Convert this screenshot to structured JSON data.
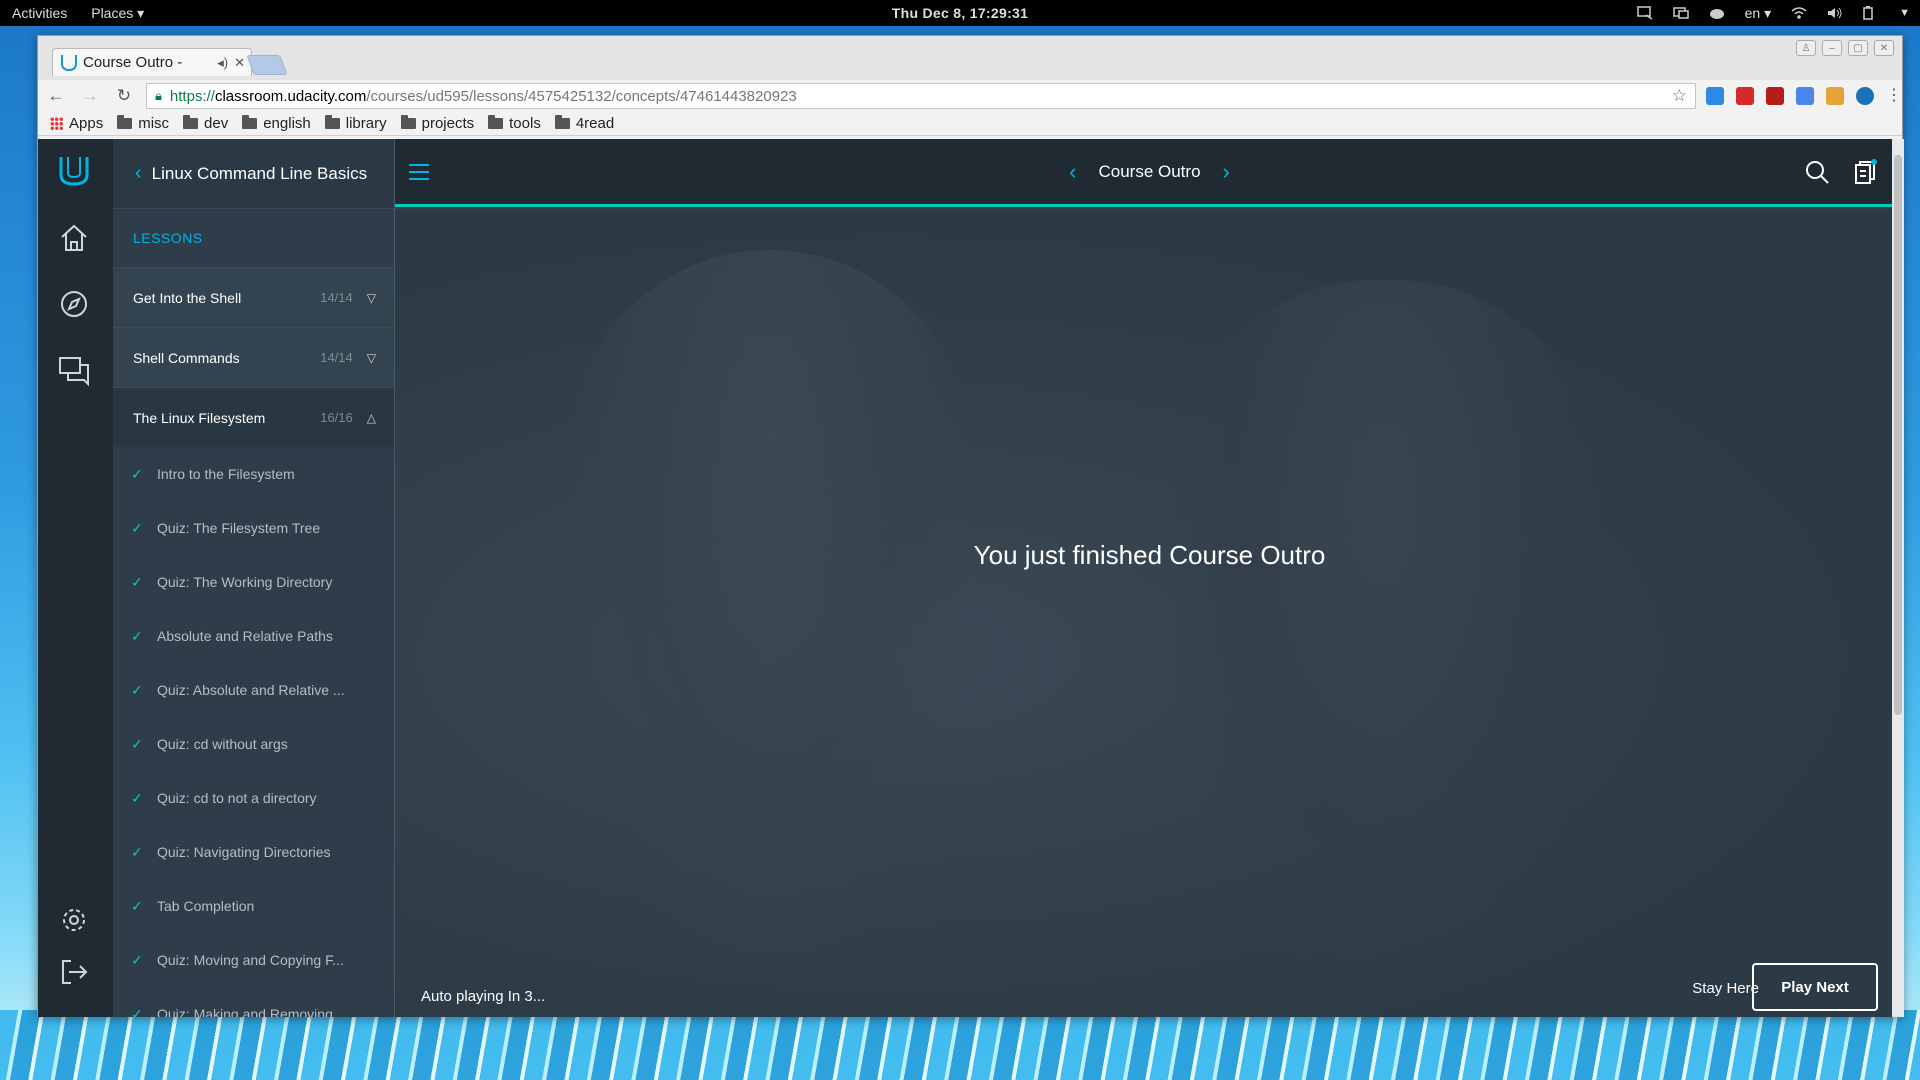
{
  "topbar": {
    "activities": "Activities",
    "places": "Places ▾",
    "clock": "Thu Dec  8, 17:29:31",
    "language": "en ▾"
  },
  "browser": {
    "tab_title": "Course Outro -",
    "url_scheme": "https://",
    "url_host": "classroom.udacity.com",
    "url_path": "/courses/ud595/lessons/4575425132/concepts/47461443820923",
    "bookmarks": [
      "Apps",
      "misc",
      "dev",
      "english",
      "library",
      "projects",
      "tools",
      "4read"
    ]
  },
  "sidebar": {
    "course_title": "Linux Command Line Basics",
    "lessons_label": "LESSONS",
    "lessons": [
      {
        "title": "Get Into the Shell",
        "count": "14/14"
      },
      {
        "title": "Shell Commands",
        "count": "14/14"
      },
      {
        "title": "The Linux Filesystem",
        "count": "16/16"
      }
    ],
    "concepts": [
      "Intro to the Filesystem",
      "Quiz: The Filesystem Tree",
      "Quiz: The Working Directory",
      "Absolute and Relative Paths",
      "Quiz: Absolute and Relative ...",
      "Quiz: cd without args",
      "Quiz: cd to not a directory",
      "Quiz: Navigating Directories",
      "Tab Completion",
      "Quiz: Moving and Copying F...",
      "Quiz: Making and Removing..."
    ]
  },
  "header": {
    "title": "Course Outro"
  },
  "video": {
    "message": "You just finished Course Outro",
    "autoplay": "Auto playing In  3...",
    "stay_label": "Stay Here",
    "play_next_label": "Play Next"
  },
  "colors": {
    "accent": "#02b3e4",
    "teal": "#02ccba",
    "panel": "#2e3d49",
    "rail": "#1f2a33"
  }
}
